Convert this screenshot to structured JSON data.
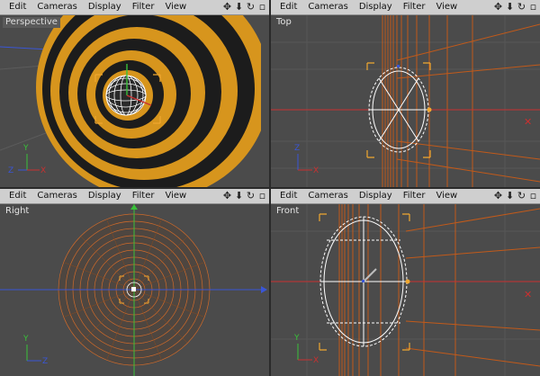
{
  "menu": [
    "Edit",
    "Cameras",
    "Display",
    "Filter",
    "View"
  ],
  "nav_icons": [
    "move-view-icon",
    "dolly-view-icon",
    "rotate-view-icon",
    "maximize-view-icon"
  ],
  "views": {
    "perspective": "Perspective",
    "top": "Top",
    "right": "Right",
    "front": "Front"
  },
  "axis_labels": {
    "x": "X",
    "y": "Y",
    "z": "Z"
  },
  "colors": {
    "viewport_bg": "#4b4b4b",
    "menubar_bg": "#cfcfcf",
    "grid_line": "#5e5e5e",
    "object_orange": "#d98a2b",
    "bbox_corner": "#f0a830",
    "x_axis": "#c93030",
    "y_axis": "#39c039",
    "z_axis": "#3a56d6",
    "selection_white": "#ffffff"
  }
}
